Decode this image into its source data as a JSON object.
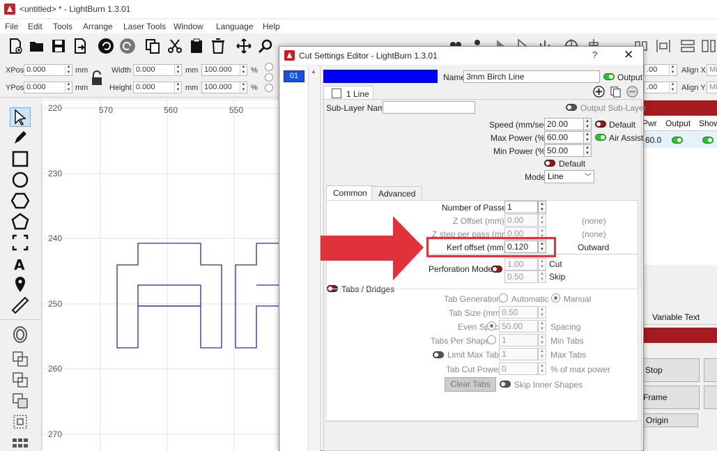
{
  "window": {
    "title": "<untitled> * - LightBurn 1.3.01"
  },
  "menu": [
    "File",
    "Edit",
    "Tools",
    "Arrange",
    "Laser Tools",
    "Window",
    "Language",
    "Help"
  ],
  "numbar": {
    "xpos_label": "XPos",
    "xpos": "0.000",
    "ypos_label": "YPos",
    "ypos": "0.000",
    "unit": "mm",
    "width_label": "Width",
    "width": "0.000",
    "height_label": "Height",
    "height": "0.000",
    "scale_w": "100.000",
    "scale_h": "100.000",
    "pct": "%"
  },
  "rulers": {
    "top": [
      "570",
      "560",
      "550"
    ],
    "left": [
      "220",
      "230",
      "240",
      "250",
      "260",
      "270"
    ]
  },
  "right_panel": {
    "align_x_label": "Align X",
    "align_y_label": "Align Y",
    "align_val": "Mic",
    "input1": ".00",
    "input2": ".00",
    "cols": [
      "Pwr",
      "Output",
      "Show"
    ],
    "pwr_val": "60.0",
    "variable_text": "Variable Text",
    "stop": "Stop",
    "frame": "Frame",
    "origin": "Origin"
  },
  "dialog": {
    "title": "Cut Settings Editor - LightBurn 1.3.01",
    "help": "?",
    "close": "✕",
    "layer_id": "01",
    "layer_color": "#0000ff",
    "name_label": "Name",
    "name_value": "3mm Birch Line",
    "output_label": "Output",
    "sublayer_tab": "1 Line",
    "sublayer_name_label": "Sub-Layer Name",
    "sublayer_name_value": "",
    "output_sublayer_label": "Output Sub-Layer",
    "speed_label": "Speed (mm/sec)",
    "speed": "20.00",
    "default_label": "Default",
    "maxpower_label": "Max Power (%)",
    "maxpower": "60.00",
    "airassist_label": "Air Assist",
    "minpower_label": "Min Power (%)",
    "minpower": "50.00",
    "default2_label": "Default",
    "mode_label": "Mode",
    "mode": "Line",
    "tabs": [
      "Common",
      "Advanced"
    ],
    "passes_label": "Number of Passes",
    "passes": "1",
    "zoffset_label": "Z Offset (mm)",
    "zoffset": "0.00",
    "zoffset_note": "(none)",
    "zstep_label": "Z step per pass (mm)",
    "zstep": "0.00",
    "zstep_note": "(none)",
    "kerf_label": "Kerf offset (mm)",
    "kerf": "0.120",
    "kerf_note": "Outward",
    "perf_label": "Perforation Mode",
    "perf_cut": "1.00",
    "cut_label": "Cut",
    "perf_skip": "0.50",
    "skip_label": "Skip",
    "tabs_bridges_label": "Tabs / Bridges",
    "tabgen_label": "Tab Generation",
    "automatic_label": "Automatic",
    "manual_label": "Manual",
    "tabsize_label": "Tab Size (mm)",
    "tabsize": "0.50",
    "evenspacing_label": "Even Spacing",
    "evenspacing": "50.00",
    "spacing_label": "Spacing",
    "tabspershape_label": "Tabs Per Shape",
    "tabspershape": "1",
    "mintabs_label": "Min Tabs",
    "limitmaxtabs_label": "Limit Max Tabs",
    "limitmaxtabs": "1",
    "maxtabs_label": "Max Tabs",
    "tabcutpower_label": "Tab Cut Power",
    "tabcutpower": "0",
    "pctmax_label": "% of max power",
    "cleartabs_label": "Clear Tabs",
    "skipinner_label": "Skip Inner Shapes"
  },
  "colors": {
    "accent_red": "#e0323a",
    "layer_blue": "#0000ff",
    "toggle_on": "#2fbf2f",
    "toggle_off": "#8b1a1a"
  }
}
